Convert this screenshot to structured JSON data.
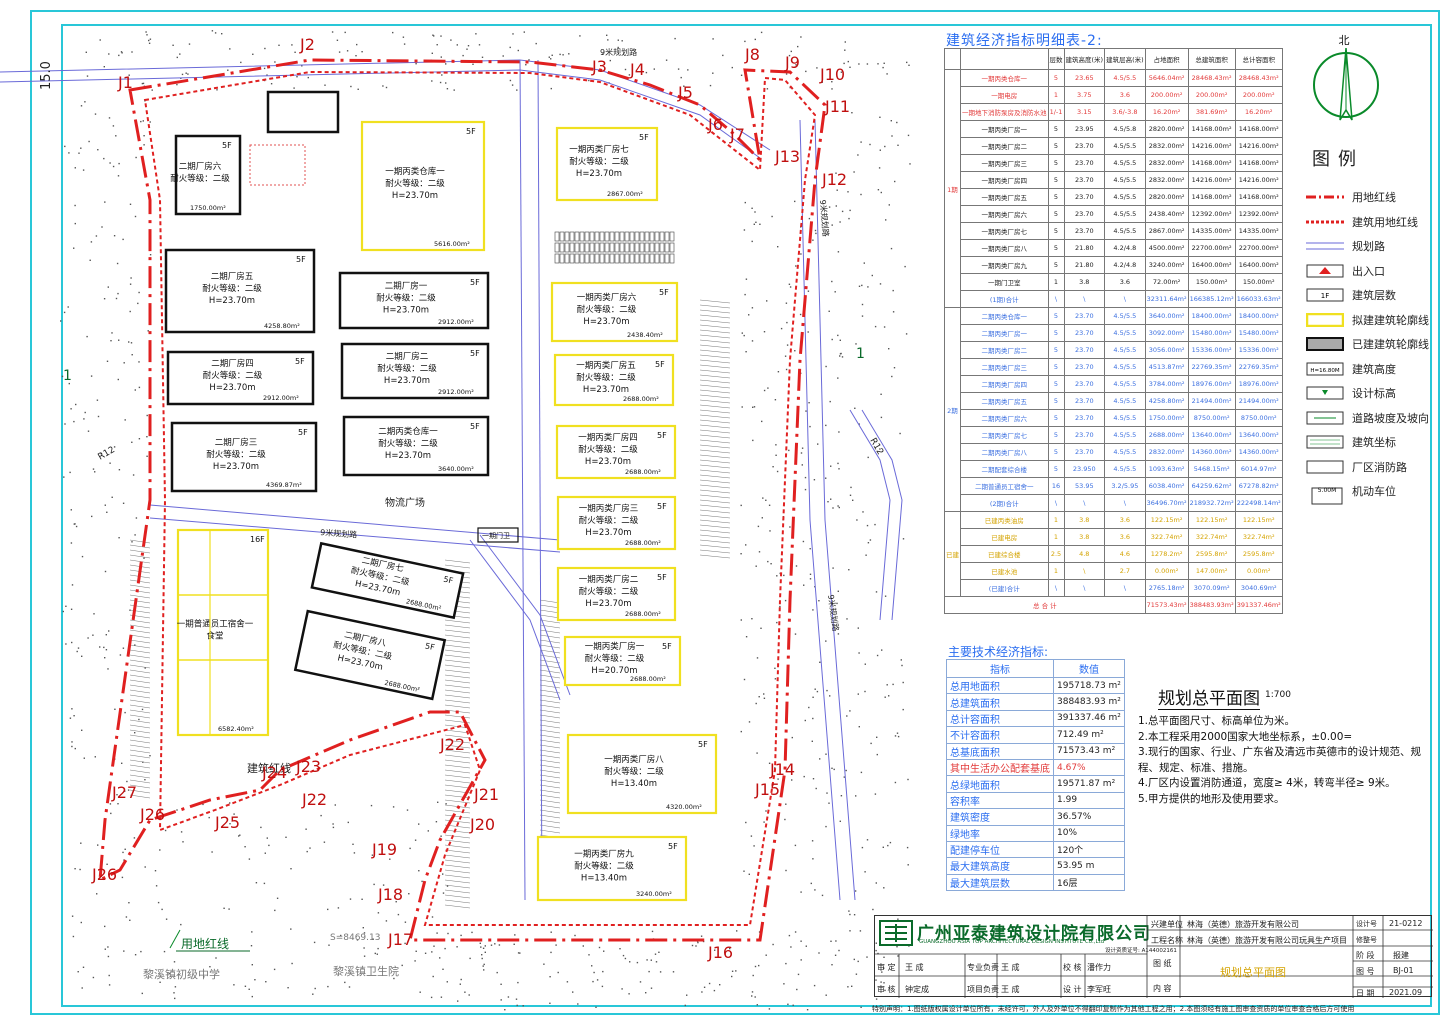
{
  "econ_table": {
    "title": "建筑经济指标明细表-2:",
    "headers": [
      "",
      "",
      "层数",
      "建筑高度(米)",
      "建筑层高(米)",
      "占地面积",
      "总建筑面积",
      "总计容面积"
    ],
    "phase1_label": "1期",
    "phase1_rows": [
      {
        "name": "一期丙类仓库一",
        "floors": "5",
        "height": "23.65",
        "storey": "4.5/5.5",
        "footprint": "5646.04m²",
        "gfa": "28468.43m²",
        "far": "28468.43m²",
        "color": "r"
      },
      {
        "name": "一期电房",
        "floors": "1",
        "height": "3.75",
        "storey": "3.6",
        "footprint": "200.00m²",
        "gfa": "200.00m²",
        "far": "200.00m²",
        "color": "r"
      },
      {
        "name": "一期地下消防泵房及消防水池",
        "floors": "1/-1",
        "height": "3.15",
        "storey": "3.6/-3.8",
        "footprint": "16.20m²",
        "gfa": "381.69m²",
        "far": "16.20m²",
        "color": "r"
      },
      {
        "name": "一期丙类厂房一",
        "floors": "5",
        "height": "23.95",
        "storey": "4.5/5.8",
        "footprint": "2820.00m²",
        "gfa": "14168.00m²",
        "far": "14168.00m²",
        "color": ""
      },
      {
        "name": "一期丙类厂房二",
        "floors": "5",
        "height": "23.70",
        "storey": "4.5/5.5",
        "footprint": "2832.00m²",
        "gfa": "14216.00m²",
        "far": "14216.00m²",
        "color": ""
      },
      {
        "name": "一期丙类厂房三",
        "floors": "5",
        "height": "23.70",
        "storey": "4.5/5.5",
        "footprint": "2832.00m²",
        "gfa": "14168.00m²",
        "far": "14168.00m²",
        "color": ""
      },
      {
        "name": "一期丙类厂房四",
        "floors": "5",
        "height": "23.70",
        "storey": "4.5/5.5",
        "footprint": "2832.00m²",
        "gfa": "14216.00m²",
        "far": "14216.00m²",
        "color": ""
      },
      {
        "name": "一期丙类厂房五",
        "floors": "5",
        "height": "23.70",
        "storey": "4.5/5.5",
        "footprint": "2820.00m²",
        "gfa": "14168.00m²",
        "far": "14168.00m²",
        "color": ""
      },
      {
        "name": "一期丙类厂房六",
        "floors": "5",
        "height": "23.70",
        "storey": "4.5/5.5",
        "footprint": "2438.40m²",
        "gfa": "12392.00m²",
        "far": "12392.00m²",
        "color": ""
      },
      {
        "name": "一期丙类厂房七",
        "floors": "5",
        "height": "23.70",
        "storey": "4.5/5.5",
        "footprint": "2867.00m²",
        "gfa": "14335.00m²",
        "far": "14335.00m²",
        "color": ""
      },
      {
        "name": "一期丙类厂房八",
        "floors": "5",
        "height": "21.80",
        "storey": "4.2/4.8",
        "footprint": "4500.00m²",
        "gfa": "22700.00m²",
        "far": "22700.00m²",
        "color": ""
      },
      {
        "name": "一期丙类厂房九",
        "floors": "5",
        "height": "21.80",
        "storey": "4.2/4.8",
        "footprint": "3240.00m²",
        "gfa": "16400.00m²",
        "far": "16400.00m²",
        "color": ""
      },
      {
        "name": "一期门卫室",
        "floors": "1",
        "height": "3.8",
        "storey": "3.6",
        "footprint": "72.00m²",
        "gfa": "150.00m²",
        "far": "150.00m²",
        "color": ""
      },
      {
        "name": "(1期)合计",
        "floors": "\\",
        "height": "\\",
        "storey": "\\",
        "footprint": "32311.64m²",
        "gfa": "166385.12m²",
        "far": "166033.63m²",
        "color": "total"
      }
    ],
    "phase2_label": "2期",
    "phase2_rows": [
      {
        "name": "二期丙类仓库一",
        "floors": "5",
        "height": "23.70",
        "storey": "4.5/5.5",
        "footprint": "3640.00m²",
        "gfa": "18400.00m²",
        "far": "18400.00m²",
        "color": "b"
      },
      {
        "name": "二期丙类厂房一",
        "floors": "5",
        "height": "23.70",
        "storey": "4.5/5.5",
        "footprint": "3092.00m²",
        "gfa": "15480.00m²",
        "far": "15480.00m²",
        "color": "b"
      },
      {
        "name": "二期丙类厂房二",
        "floors": "5",
        "height": "23.70",
        "storey": "4.5/5.5",
        "footprint": "3056.00m²",
        "gfa": "15336.00m²",
        "far": "15336.00m²",
        "color": "b"
      },
      {
        "name": "二期丙类厂房三",
        "floors": "5",
        "height": "23.70",
        "storey": "4.5/5.5",
        "footprint": "4513.87m²",
        "gfa": "22769.35m²",
        "far": "22769.35m²",
        "color": "b"
      },
      {
        "name": "二期丙类厂房四",
        "floors": "5",
        "height": "23.70",
        "storey": "4.5/5.5",
        "footprint": "3784.00m²",
        "gfa": "18976.00m²",
        "far": "18976.00m²",
        "color": "b"
      },
      {
        "name": "二期丙类厂房五",
        "floors": "5",
        "height": "23.70",
        "storey": "4.5/5.5",
        "footprint": "4258.80m²",
        "gfa": "21494.00m²",
        "far": "21494.00m²",
        "color": "b"
      },
      {
        "name": "二期丙类厂房六",
        "floors": "5",
        "height": "23.70",
        "storey": "4.5/5.5",
        "footprint": "1750.00m²",
        "gfa": "8750.00m²",
        "far": "8750.00m²",
        "color": "b"
      },
      {
        "name": "二期丙类厂房七",
        "floors": "5",
        "height": "23.70",
        "storey": "4.5/5.5",
        "footprint": "2688.00m²",
        "gfa": "13640.00m²",
        "far": "13640.00m²",
        "color": "b"
      },
      {
        "name": "二期丙类厂房八",
        "floors": "5",
        "height": "23.70",
        "storey": "4.5/5.5",
        "footprint": "2832.00m²",
        "gfa": "14360.00m²",
        "far": "14360.00m²",
        "color": "b"
      },
      {
        "name": "二期配套综合楼",
        "floors": "5",
        "height": "23.950",
        "storey": "4.5/5.5",
        "footprint": "1093.63m²",
        "gfa": "5468.15m²",
        "far": "6014.97m²",
        "color": "b"
      },
      {
        "name": "二期普通员工宿舍一",
        "floors": "16",
        "height": "53.95",
        "storey": "3.2/5.95",
        "footprint": "6038.40m²",
        "gfa": "64259.62m²",
        "far": "67278.82m²",
        "color": "b"
      },
      {
        "name": "(2期)合计",
        "floors": "\\",
        "height": "\\",
        "storey": "\\",
        "footprint": "36496.70m²",
        "gfa": "218932.72m²",
        "far": "222498.14m²",
        "color": "total"
      }
    ],
    "existing_label": "已建",
    "existing_rows": [
      {
        "name": "已建丙类油房",
        "floors": "1",
        "height": "3.8",
        "storey": "3.6",
        "footprint": "122.15m²",
        "gfa": "122.15m²",
        "far": "122.15m²",
        "color": "y"
      },
      {
        "name": "已建电房",
        "floors": "1",
        "height": "3.8",
        "storey": "3.6",
        "footprint": "322.74m²",
        "gfa": "322.74m²",
        "far": "322.74m²",
        "color": "y"
      },
      {
        "name": "已建综合楼",
        "floors": "2.5",
        "height": "4.8",
        "storey": "4.6",
        "footprint": "1278.2m²",
        "gfa": "2595.8m²",
        "far": "2595.8m²",
        "color": "y"
      },
      {
        "name": "已建水池",
        "floors": "1",
        "height": "\\",
        "storey": "2.7",
        "footprint": "0.00m²",
        "gfa": "147.00m²",
        "far": "0.00m²",
        "color": "y"
      },
      {
        "name": "(已建)合计",
        "floors": "\\",
        "height": "\\",
        "storey": "\\",
        "footprint": "2765.18m²",
        "gfa": "3070.09m²",
        "far": "3040.69m²",
        "color": "total"
      }
    ],
    "total_label": "总 合 计",
    "total_values": [
      "71573.43m²",
      "388483.93m²",
      "391337.46m²"
    ]
  },
  "north": "北",
  "legend": {
    "title": "图例",
    "items": [
      {
        "label": "用地红线",
        "icon": "site-redline-icon"
      },
      {
        "label": "建筑用地红线",
        "icon": "building-redline-icon"
      },
      {
        "label": "规划路",
        "icon": "planned-road-icon"
      },
      {
        "label": "出入口",
        "icon": "entrance-arrow-icon"
      },
      {
        "label": "建筑层数",
        "icon": "floors-box-icon",
        "sym": "1F"
      },
      {
        "label": "拟建建筑轮廓线",
        "icon": "proposed-outline-icon"
      },
      {
        "label": "已建建筑轮廓线",
        "icon": "existing-outline-icon"
      },
      {
        "label": "建筑高度",
        "icon": "height-box-icon",
        "sym": "H=16.80M"
      },
      {
        "label": "设计标高",
        "icon": "elevation-icon"
      },
      {
        "label": "道路坡度及坡向",
        "icon": "slope-icon"
      },
      {
        "label": "建筑坐标",
        "icon": "coordinate-icon"
      },
      {
        "label": "厂区消防路",
        "icon": "fire-road-icon"
      },
      {
        "label": "机动车位",
        "icon": "parking-icon",
        "sym": "5.00M"
      }
    ]
  },
  "tech": {
    "title": "主要技术经济指标:",
    "headers": [
      "指标",
      "数值"
    ],
    "rows": [
      {
        "k": "总用地面积",
        "v": "195718.73 m²"
      },
      {
        "k": "总建筑面积",
        "v": "388483.93 m²"
      },
      {
        "k": "总计容面积",
        "v": "391337.46 m²"
      },
      {
        "k": "不计容面积",
        "v": "712.49 m²"
      },
      {
        "k": "总基底面积",
        "v": "71573.43 m²"
      },
      {
        "k": "其中生活办公配套基底",
        "v": "4.67%"
      },
      {
        "k": "总绿地面积",
        "v": "19571.87 m²"
      },
      {
        "k": "容积率",
        "v": "1.99"
      },
      {
        "k": "建筑密度",
        "v": "36.57%"
      },
      {
        "k": "绿地率",
        "v": "10%"
      },
      {
        "k": "配建停车位",
        "v": "120个"
      },
      {
        "k": "最大建筑高度",
        "v": "53.95 m"
      },
      {
        "k": "最大建筑层数",
        "v": "16层"
      }
    ]
  },
  "plan": {
    "title": "规划总平面图",
    "scale": "1:700",
    "notes": [
      "1.总平面图尺寸、标高单位为米。",
      "2.本工程采用2000国家大地坐标系，±0.00=",
      "3.现行的国家、行业、广东省及清远市英德市的设计规范、规程、规定、标准、措施。",
      "4.厂区内设置消防通道，宽度≥ 4米，转弯半径≥ 9米。",
      "5.甲方提供的地形及使用要求。"
    ]
  },
  "title_block": {
    "company": "广州亚泰建筑设计院有限公司",
    "company_en": "GUANGZHOU ASIA TOP ARCHITECTURAL DESIGN INSTITUTE Co.,Ltd",
    "cert": "设计资质证号: A144002161",
    "client_label": "兴建单位",
    "client": "林海（英德）旅游开发有限公司",
    "project_label": "工程名称",
    "project": "林海（英德）旅游开发有限公司玩具生产项目",
    "drawing_label": "图 纸",
    "drawing": "规划总平面图",
    "content_label": "内 容",
    "no_label": "设计号",
    "no": "21-0212",
    "stage_label": "阶 段",
    "stage": "报建",
    "sheet_label": "图 号",
    "sheet": "BJ-01",
    "date_label": "日 期",
    "date": "2021.09",
    "cert_label": "修整号",
    "roles": [
      {
        "r": "审 定",
        "n": "王 成"
      },
      {
        "r": "专业负责",
        "n": "王 成"
      },
      {
        "r": "校 核",
        "n": "潘作力"
      },
      {
        "r": "审 核",
        "n": "钟定成"
      },
      {
        "r": "项目负责",
        "n": "王 成"
      },
      {
        "r": "设 计",
        "n": "李军旺"
      }
    ],
    "declaration": "特别声明：1.图纸版权属设计单位所有，未经许可，外人及外单位不得翻印复制作为其他工程之用；2.本图须经有施工图审查资质的单位审查合格后方可使用"
  },
  "site": {
    "road_top": "9米规划路",
    "road_mid": "9米规划路",
    "road_right": "9米规划路",
    "road_diag": "9米规划路",
    "logistics": "物流广场",
    "gate": "一期门卫",
    "redline_label": "建筑红线",
    "site_label": "用地红线",
    "school": "黎溪镇初级中学",
    "hospital": "黎溪镇卫生院",
    "area_note": "S=8469.13",
    "r12a": "R12",
    "r12b": "R12",
    "top_label": "15.0",
    "section_mark": "1",
    "buildings": [
      {
        "name": "一期丙类仓库一",
        "fire": "耐火等级：二级",
        "h": "H=23.70m",
        "area": "5616.00m²",
        "fl": "5F"
      },
      {
        "name": "一期丙类厂房七",
        "fire": "耐火等级：二级",
        "h": "H=23.70m",
        "area": "2867.00m²",
        "fl": "5F"
      },
      {
        "name": "一期丙类厂房六",
        "fire": "耐火等级：二级",
        "h": "H=23.70m",
        "area": "2438.40m²",
        "fl": "5F"
      },
      {
        "name": "一期丙类厂房五",
        "fire": "耐火等级：二级",
        "h": "H=23.70m",
        "area": "2688.00m²",
        "fl": "5F"
      },
      {
        "name": "一期丙类厂房四",
        "fire": "耐火等级：二级",
        "h": "H=23.70m",
        "area": "2688.00m²",
        "fl": "5F"
      },
      {
        "name": "一期丙类厂房三",
        "fire": "耐火等级：二级",
        "h": "H=23.70m",
        "area": "2688.00m²",
        "fl": "5F"
      },
      {
        "name": "一期丙类厂房二",
        "fire": "耐火等级：二级",
        "h": "H=23.70m",
        "area": "2688.00m²",
        "fl": "5F"
      },
      {
        "name": "一期丙类厂房一",
        "fire": "耐火等级：二级",
        "h": "H=20.70m",
        "area": "2688.00m²",
        "fl": "5F"
      },
      {
        "name": "一期丙类厂房八",
        "fire": "耐火等级：二级",
        "h": "H=13.40m",
        "area": "4320.00m²",
        "fl": "5F"
      },
      {
        "name": "一期丙类厂房九",
        "fire": "耐火等级：二级",
        "h": "H=13.40m",
        "area": "3240.00m²",
        "fl": "5F"
      },
      {
        "name": "二期厂房六",
        "fire": "耐火等级：二级",
        "h": "",
        "area": "1750.00m²",
        "fl": "5F"
      },
      {
        "name": "二期厂房五",
        "fire": "耐火等级：二级",
        "h": "H=23.70m",
        "area": "4258.80m²",
        "fl": "5F"
      },
      {
        "name": "二期厂房一",
        "fire": "耐火等级：二级",
        "h": "H=23.70m",
        "area": "2912.00m²",
        "fl": "5F"
      },
      {
        "name": "二期厂房四",
        "fire": "耐火等级：二级",
        "h": "H=23.70m",
        "area": "2912.00m²",
        "fl": "5F"
      },
      {
        "name": "二期厂房二",
        "fire": "耐火等级：二级",
        "h": "H=23.70m",
        "area": "2912.00m²",
        "fl": "5F"
      },
      {
        "name": "二期厂房三",
        "fire": "耐火等级：二级",
        "h": "H=23.70m",
        "area": "4369.87m²",
        "fl": "5F"
      },
      {
        "name": "二期丙类仓库一",
        "fire": "耐火等级：二级",
        "h": "H=23.70m",
        "area": "3640.00m²",
        "fl": "5F"
      },
      {
        "name": "二期厂房七",
        "fire": "耐火等级：二级",
        "h": "H=23.70m",
        "area": "2688.00m²",
        "fl": "5F"
      },
      {
        "name": "二期厂房八",
        "fire": "耐火等级：二级",
        "h": "H=23.70m",
        "area": "2688.00m²",
        "fl": "5F"
      },
      {
        "name": "一期普通员工宿舍一",
        "fire": "",
        "h": "食堂",
        "area": "6582.40m²",
        "fl": "16F"
      }
    ],
    "points": [
      "J1",
      "J2",
      "J3",
      "J4",
      "J5",
      "J6",
      "J7",
      "J8",
      "J9",
      "J10",
      "J11",
      "J12",
      "J13",
      "J14",
      "J15",
      "J16",
      "J17",
      "J18",
      "J19",
      "J20",
      "J21",
      "J22",
      "J22",
      "J23",
      "J24",
      "J25",
      "J26",
      "J26",
      "J27"
    ]
  },
  "colors": {
    "red": "#e02020",
    "yellow": "#f0e020",
    "black": "#111111",
    "cyan": "#29c7d8",
    "blue": "#2a6df0",
    "road": "#6a6ad8"
  }
}
